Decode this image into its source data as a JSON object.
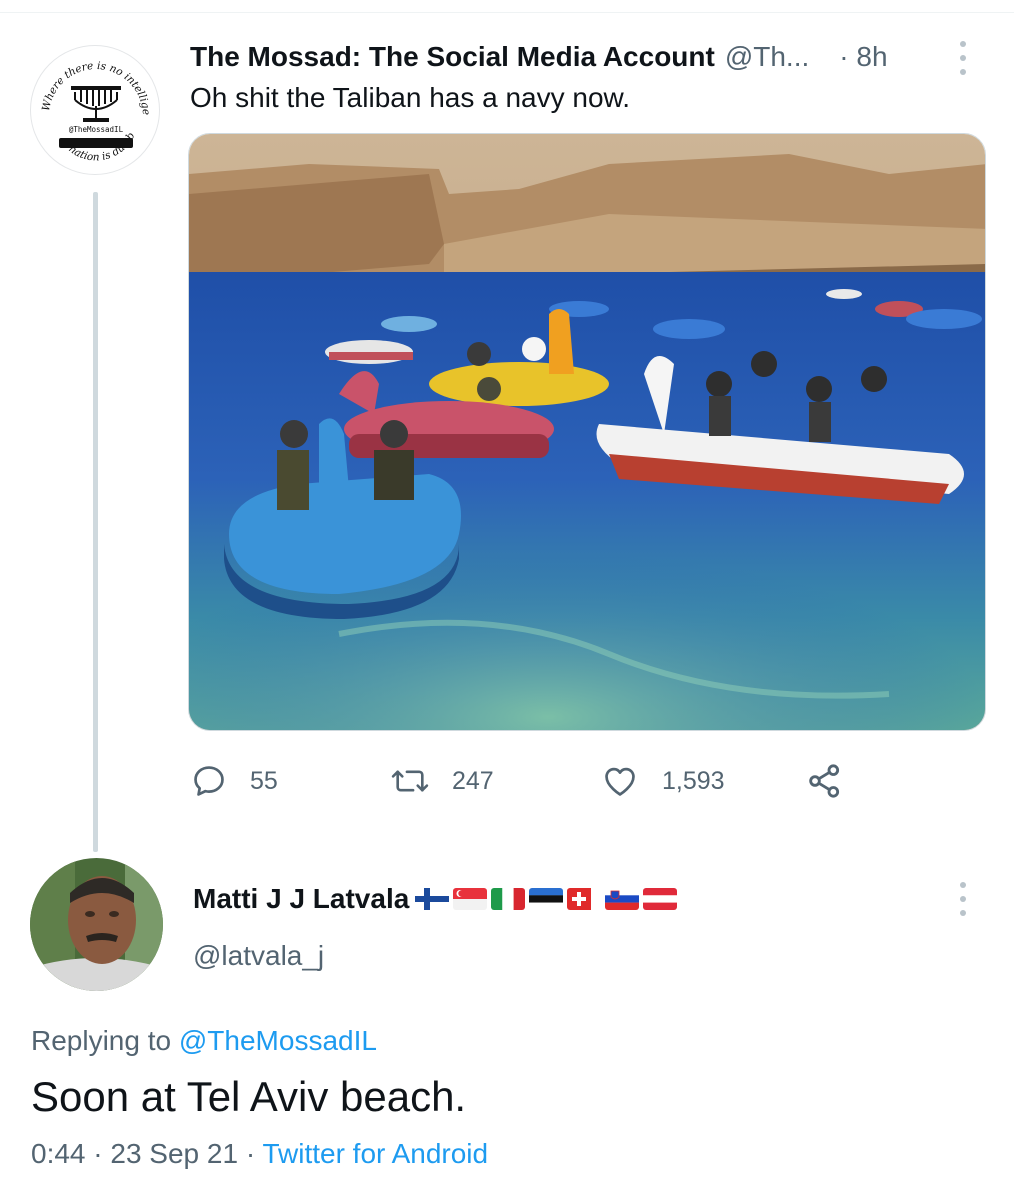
{
  "parent_tweet": {
    "author_name": "The Mossad: The Social Media Account",
    "author_handle": "@Th...",
    "time": "· 8h",
    "text": "Oh shit the Taliban has a navy now.",
    "avatar": {
      "arc_top": "Where there is no intelligence",
      "arc_bottom": "a nation is dumb",
      "handle": "@TheMossadIL"
    },
    "media_icon": "photo-pedal-boats-lake",
    "actions": {
      "reply_count": "55",
      "retweet_count": "247",
      "like_count": "1,593",
      "reply_icon": "speech-bubble-icon",
      "retweet_icon": "retweet-icon",
      "like_icon": "heart-icon",
      "share_icon": "share-icon"
    }
  },
  "reply_tweet": {
    "author_name": "Matti J J Latvala",
    "flags": [
      "finland",
      "singapore",
      "italy",
      "estonia",
      "switzerland",
      "slovenia",
      "austria"
    ],
    "author_handle": "@latvala_j",
    "replying_prefix": "Replying to ",
    "replying_to": "@TheMossadIL",
    "text": "Soon at Tel Aviv beach.",
    "timestamp": "0:44 · 23 Sep 21 · ",
    "source": "Twitter for Android"
  },
  "colors": {
    "text_primary": "#0f1419",
    "text_secondary": "#536471",
    "link": "#1d9bf0",
    "thread_line": "#cfd9de"
  }
}
